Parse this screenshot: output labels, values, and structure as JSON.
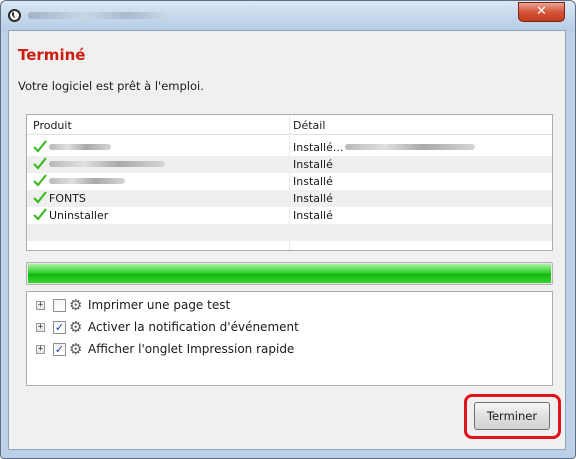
{
  "window": {
    "close_glyph": "✕"
  },
  "header": {
    "title": "Terminé",
    "subtitle": "Votre logiciel est prêt à l'emploi."
  },
  "table": {
    "columns": [
      "Produit",
      "Détail"
    ],
    "rows": [
      {
        "product": "",
        "detail": "Installé..."
      },
      {
        "product": "",
        "detail": "Installé"
      },
      {
        "product": "",
        "detail": "Installé"
      },
      {
        "product": "FONTS",
        "detail": "Installé"
      },
      {
        "product": "Uninstaller",
        "detail": "Installé"
      }
    ],
    "check_icon_color": "#3cbc1e"
  },
  "progress": {
    "percent": 100,
    "color": "#22c41c"
  },
  "options": [
    {
      "label": "Imprimer une page test",
      "checked": false,
      "expander": "+"
    },
    {
      "label": "Activer la notification d'événement",
      "checked": true,
      "expander": "+"
    },
    {
      "label": "Afficher l'onglet Impression rapide",
      "checked": true,
      "expander": "+"
    }
  ],
  "footer": {
    "finish_label": "Terminer",
    "highlight_color": "#e0121a"
  }
}
